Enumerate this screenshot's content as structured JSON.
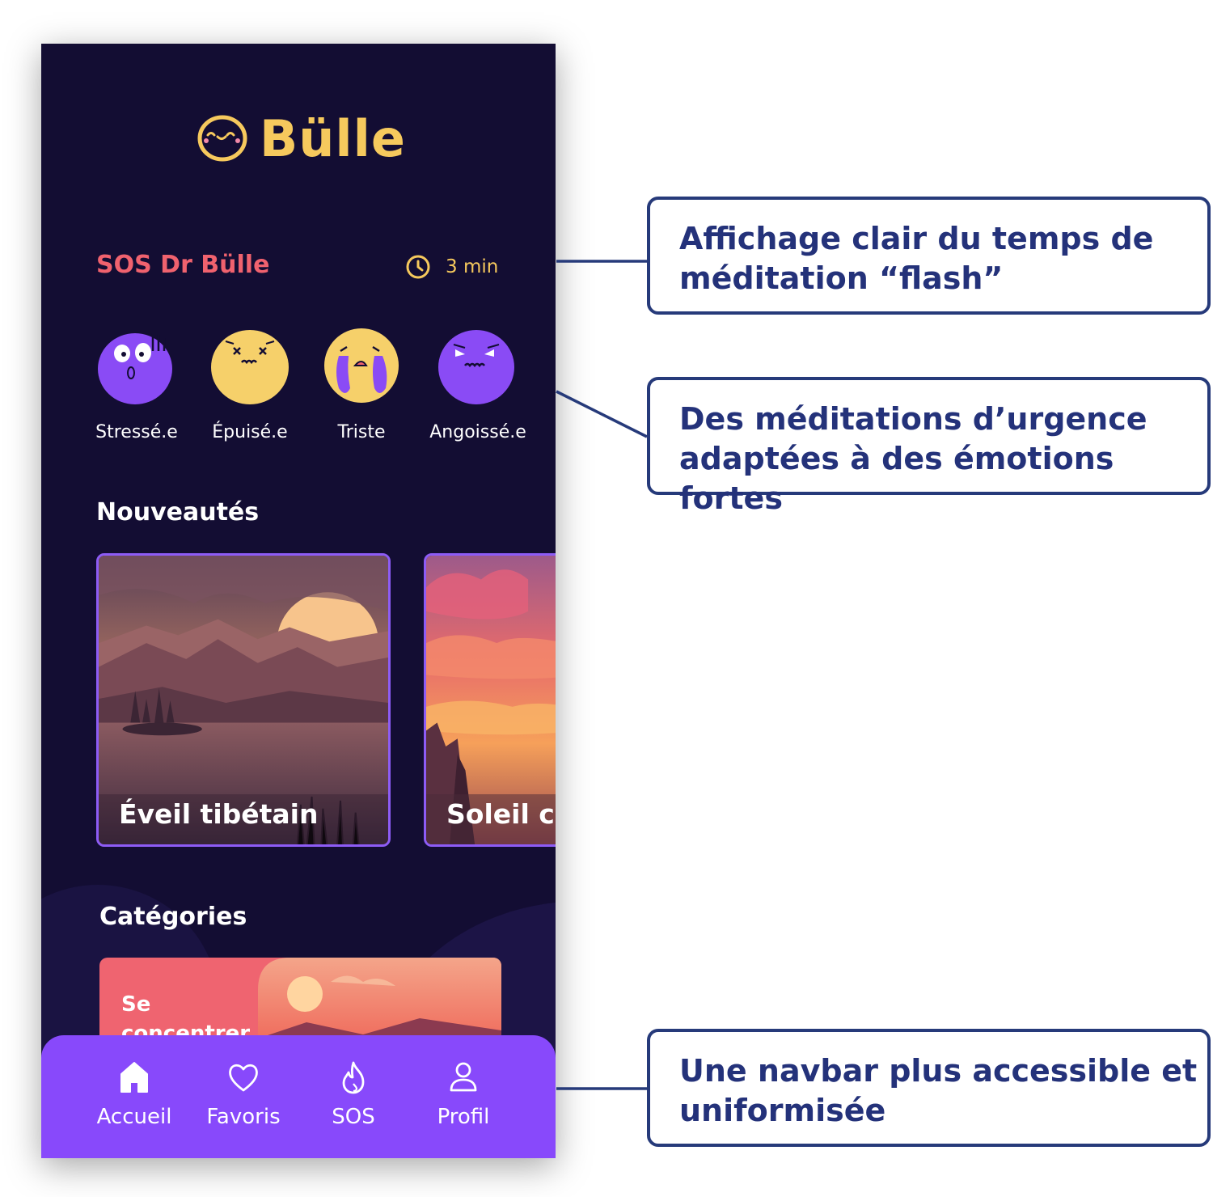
{
  "app": {
    "name": "Bülle",
    "logo_icon": "smiley-bubble-icon"
  },
  "sos": {
    "title": "SOS Dr Bülle",
    "duration": "3 min",
    "duration_icon": "clock-icon"
  },
  "emotions": [
    {
      "label": "Stressé.e",
      "color": "#8a4bf5"
    },
    {
      "label": "Épuisé.e",
      "color": "#f6d06a"
    },
    {
      "label": "Triste",
      "color": "#f6d06a"
    },
    {
      "label": "Angoissé.e",
      "color": "#8a4bf5"
    }
  ],
  "news": {
    "title": "Nouveautés",
    "cards": [
      {
        "title": "Éveil tibétain"
      },
      {
        "title": "Soleil co"
      }
    ]
  },
  "categories": {
    "title": "Catégories",
    "items": [
      {
        "label": "Se concentrer"
      }
    ]
  },
  "navbar": {
    "items": [
      {
        "label": "Accueil",
        "icon": "home-icon",
        "active": true
      },
      {
        "label": "Favoris",
        "icon": "heart-icon"
      },
      {
        "label": "SOS",
        "icon": "flame-icon"
      },
      {
        "label": "Profil",
        "icon": "user-icon"
      }
    ]
  },
  "annotations": [
    {
      "line1": "Affichage clair du temps de",
      "line2": "méditation “flash”"
    },
    {
      "line1": "Des méditations d’urgence",
      "line2": "adaptées à des émotions fortes"
    },
    {
      "line1": "Une navbar plus accessible et",
      "line2": "uniformisée"
    }
  ],
  "colors": {
    "background": "#130d33",
    "accent_yellow": "#f6c95d",
    "accent_red": "#f0626e",
    "navbar": "#8849fb",
    "card_border": "#8d5cf6",
    "annotation": "#263a7a"
  }
}
